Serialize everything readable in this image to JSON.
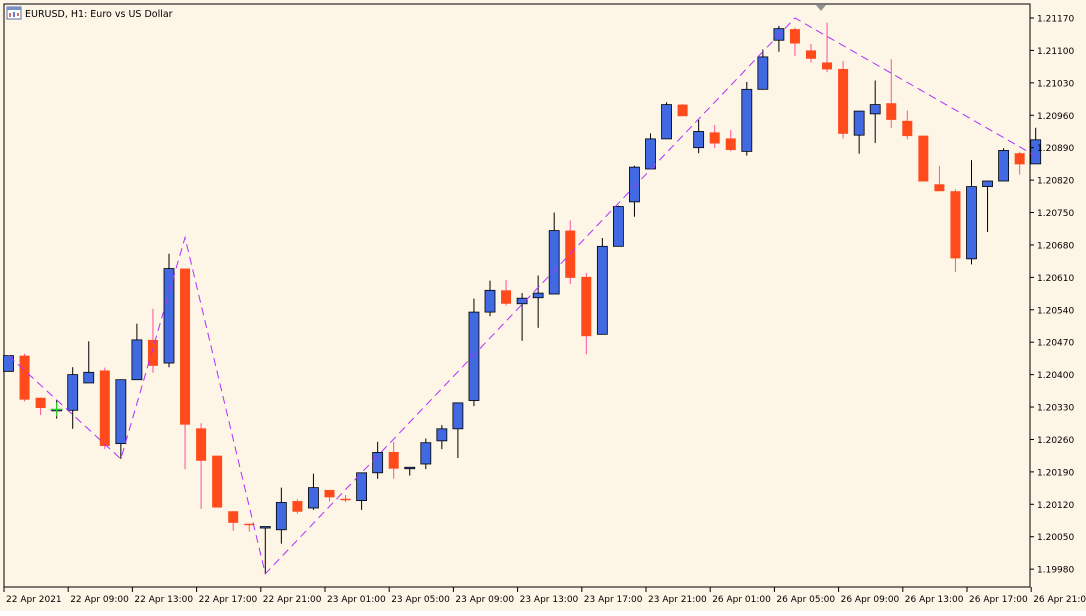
{
  "window": {
    "title": "EURUSD, H1:  Euro vs US Dollar"
  },
  "colors": {
    "background": "#fdf5e6",
    "bull_body": "#4169e1",
    "bear_body": "#ff4a1c",
    "bull_wick": "#000000",
    "bear_wick": "#ff4fa0",
    "zigzag": "#b030ff",
    "axis": "#000000",
    "crosshair": "#32cd32"
  },
  "icons": [
    "chart-window-icon",
    "nav-triangle-icon"
  ],
  "chart_data": {
    "type": "candlestick",
    "symbol": "EURUSD",
    "timeframe": "H1",
    "description": "Euro vs US Dollar",
    "ylim": [
      1.1993,
      1.2117
    ],
    "y_ticks": [
      "1.21170",
      "1.21100",
      "1.21030",
      "1.20960",
      "1.20890",
      "1.20820",
      "1.20750",
      "1.20680",
      "1.20610",
      "1.20540",
      "1.20470",
      "1.20400",
      "1.20330",
      "1.20260",
      "1.20190",
      "1.20120",
      "1.20050",
      "1.19980"
    ],
    "x_ticks": [
      {
        "index": 0,
        "label": "22 Apr 2021"
      },
      {
        "index": 4,
        "label": "22 Apr 09:00"
      },
      {
        "index": 8,
        "label": "22 Apr 13:00"
      },
      {
        "index": 12,
        "label": "22 Apr 17:00"
      },
      {
        "index": 16,
        "label": "22 Apr 21:00"
      },
      {
        "index": 20,
        "label": "23 Apr 01:00"
      },
      {
        "index": 24,
        "label": "23 Apr 05:00"
      },
      {
        "index": 28,
        "label": "23 Apr 09:00"
      },
      {
        "index": 32,
        "label": "23 Apr 13:00"
      },
      {
        "index": 36,
        "label": "23 Apr 17:00"
      },
      {
        "index": 40,
        "label": "23 Apr 21:00"
      },
      {
        "index": 44,
        "label": "26 Apr 01:00"
      },
      {
        "index": 48,
        "label": "26 Apr 05:00"
      },
      {
        "index": 52,
        "label": "26 Apr 09:00"
      },
      {
        "index": 56,
        "label": "26 Apr 13:00"
      },
      {
        "index": 60,
        "label": "26 Apr 17:00"
      },
      {
        "index": 64,
        "label": "26 Apr 21:00"
      }
    ],
    "candles": [
      {
        "o": 1.20407,
        "h": 1.20441,
        "l": 1.20407,
        "c": 1.20441
      },
      {
        "o": 1.20441,
        "h": 1.20445,
        "l": 1.20342,
        "c": 1.20346
      },
      {
        "o": 1.2035,
        "h": 1.2035,
        "l": 1.20313,
        "c": 1.20328
      },
      {
        "o": 1.20325,
        "h": 1.20345,
        "l": 1.20305,
        "c": 1.20325
      },
      {
        "o": 1.20323,
        "h": 1.20416,
        "l": 1.20283,
        "c": 1.204
      },
      {
        "o": 1.20382,
        "h": 1.20472,
        "l": 1.20382,
        "c": 1.20405
      },
      {
        "o": 1.20409,
        "h": 1.20415,
        "l": 1.20239,
        "c": 1.20246
      },
      {
        "o": 1.20251,
        "h": 1.20389,
        "l": 1.20218,
        "c": 1.20389
      },
      {
        "o": 1.20389,
        "h": 1.2051,
        "l": 1.20389,
        "c": 1.20475
      },
      {
        "o": 1.20475,
        "h": 1.20542,
        "l": 1.20404,
        "c": 1.20419
      },
      {
        "o": 1.20425,
        "h": 1.20661,
        "l": 1.20416,
        "c": 1.20629
      },
      {
        "o": 1.20629,
        "h": 1.20629,
        "l": 1.20196,
        "c": 1.20292
      },
      {
        "o": 1.20284,
        "h": 1.20295,
        "l": 1.2011,
        "c": 1.20214
      },
      {
        "o": 1.20225,
        "h": 1.20225,
        "l": 1.20114,
        "c": 1.20113
      },
      {
        "o": 1.20105,
        "h": 1.20105,
        "l": 1.20063,
        "c": 1.2008
      },
      {
        "o": 1.20078,
        "h": 1.20078,
        "l": 1.20061,
        "c": 1.20077
      },
      {
        "o": 1.2007,
        "h": 1.2007,
        "l": 1.1997,
        "c": 1.20072
      },
      {
        "o": 1.20065,
        "h": 1.20156,
        "l": 1.20035,
        "c": 1.20124
      },
      {
        "o": 1.20127,
        "h": 1.20131,
        "l": 1.201,
        "c": 1.20104
      },
      {
        "o": 1.20112,
        "h": 1.20186,
        "l": 1.20108,
        "c": 1.20156
      },
      {
        "o": 1.20151,
        "h": 1.20151,
        "l": 1.20126,
        "c": 1.20135
      },
      {
        "o": 1.20132,
        "h": 1.2014,
        "l": 1.20125,
        "c": 1.20129
      },
      {
        "o": 1.20128,
        "h": 1.20188,
        "l": 1.20108,
        "c": 1.20188
      },
      {
        "o": 1.20188,
        "h": 1.20255,
        "l": 1.20175,
        "c": 1.20232
      },
      {
        "o": 1.20233,
        "h": 1.20255,
        "l": 1.20175,
        "c": 1.20197
      },
      {
        "o": 1.202,
        "h": 1.202,
        "l": 1.20182,
        "c": 1.202
      },
      {
        "o": 1.20207,
        "h": 1.20262,
        "l": 1.20196,
        "c": 1.20253
      },
      {
        "o": 1.20257,
        "h": 1.20291,
        "l": 1.20239,
        "c": 1.20283
      },
      {
        "o": 1.20283,
        "h": 1.2034,
        "l": 1.2022,
        "c": 1.20339
      },
      {
        "o": 1.20344,
        "h": 1.20564,
        "l": 1.20332,
        "c": 1.20535
      },
      {
        "o": 1.20535,
        "h": 1.20603,
        "l": 1.20526,
        "c": 1.20582
      },
      {
        "o": 1.20582,
        "h": 1.20604,
        "l": 1.20549,
        "c": 1.20553
      },
      {
        "o": 1.20553,
        "h": 1.20576,
        "l": 1.20473,
        "c": 1.20565
      },
      {
        "o": 1.20566,
        "h": 1.20614,
        "l": 1.20501,
        "c": 1.20576
      },
      {
        "o": 1.20574,
        "h": 1.2075,
        "l": 1.20574,
        "c": 1.20711
      },
      {
        "o": 1.20711,
        "h": 1.20733,
        "l": 1.20596,
        "c": 1.20609
      },
      {
        "o": 1.20611,
        "h": 1.20619,
        "l": 1.20444,
        "c": 1.20483
      },
      {
        "o": 1.20487,
        "h": 1.20695,
        "l": 1.20487,
        "c": 1.20677
      },
      {
        "o": 1.20677,
        "h": 1.20765,
        "l": 1.20677,
        "c": 1.20763
      },
      {
        "o": 1.20773,
        "h": 1.20851,
        "l": 1.20741,
        "c": 1.20848
      },
      {
        "o": 1.20844,
        "h": 1.20921,
        "l": 1.20844,
        "c": 1.20909
      },
      {
        "o": 1.20909,
        "h": 1.20988,
        "l": 1.20909,
        "c": 1.20983
      },
      {
        "o": 1.20983,
        "h": 1.20984,
        "l": 1.20961,
        "c": 1.20958
      },
      {
        "o": 1.2089,
        "h": 1.2095,
        "l": 1.20878,
        "c": 1.20925
      },
      {
        "o": 1.20923,
        "h": 1.20939,
        "l": 1.20889,
        "c": 1.20899
      },
      {
        "o": 1.2091,
        "h": 1.20928,
        "l": 1.20882,
        "c": 1.20885
      },
      {
        "o": 1.20882,
        "h": 1.21032,
        "l": 1.20873,
        "c": 1.21016
      },
      {
        "o": 1.21016,
        "h": 1.21102,
        "l": 1.21016,
        "c": 1.21086
      },
      {
        "o": 1.21122,
        "h": 1.21153,
        "l": 1.21097,
        "c": 1.21147
      },
      {
        "o": 1.21146,
        "h": 1.21149,
        "l": 1.21088,
        "c": 1.21115
      },
      {
        "o": 1.211,
        "h": 1.21114,
        "l": 1.21074,
        "c": 1.21082
      },
      {
        "o": 1.21074,
        "h": 1.2116,
        "l": 1.21053,
        "c": 1.21059
      },
      {
        "o": 1.2106,
        "h": 1.21077,
        "l": 1.2091,
        "c": 1.2092
      },
      {
        "o": 1.20917,
        "h": 1.20965,
        "l": 1.20877,
        "c": 1.20969
      },
      {
        "o": 1.20963,
        "h": 1.21035,
        "l": 1.209,
        "c": 1.20983
      },
      {
        "o": 1.20986,
        "h": 1.21081,
        "l": 1.20933,
        "c": 1.2095
      },
      {
        "o": 1.20948,
        "h": 1.2097,
        "l": 1.20908,
        "c": 1.20915
      },
      {
        "o": 1.20916,
        "h": 1.20916,
        "l": 1.20817,
        "c": 1.20817
      },
      {
        "o": 1.20811,
        "h": 1.20851,
        "l": 1.20797,
        "c": 1.20796
      },
      {
        "o": 1.20796,
        "h": 1.208,
        "l": 1.20622,
        "c": 1.20651
      },
      {
        "o": 1.2065,
        "h": 1.20863,
        "l": 1.20638,
        "c": 1.20806
      },
      {
        "o": 1.20806,
        "h": 1.20819,
        "l": 1.20708,
        "c": 1.20818
      },
      {
        "o": 1.20818,
        "h": 1.20889,
        "l": 1.20818,
        "c": 1.20884
      },
      {
        "o": 1.20878,
        "h": 1.20881,
        "l": 1.20832,
        "c": 1.20854
      },
      {
        "o": 1.20855,
        "h": 1.20933,
        "l": 1.20855,
        "c": 1.20907
      }
    ],
    "zigzag": [
      {
        "index": 0,
        "price": 1.20441
      },
      {
        "index": 7,
        "price": 1.20218
      },
      {
        "index": 11,
        "price": 1.20696
      },
      {
        "index": 16,
        "price": 1.1997
      },
      {
        "index": 49,
        "price": 1.2117
      },
      {
        "index": 64,
        "price": 1.20872
      }
    ],
    "crosshair": {
      "index": 3,
      "price": 1.20325
    }
  }
}
